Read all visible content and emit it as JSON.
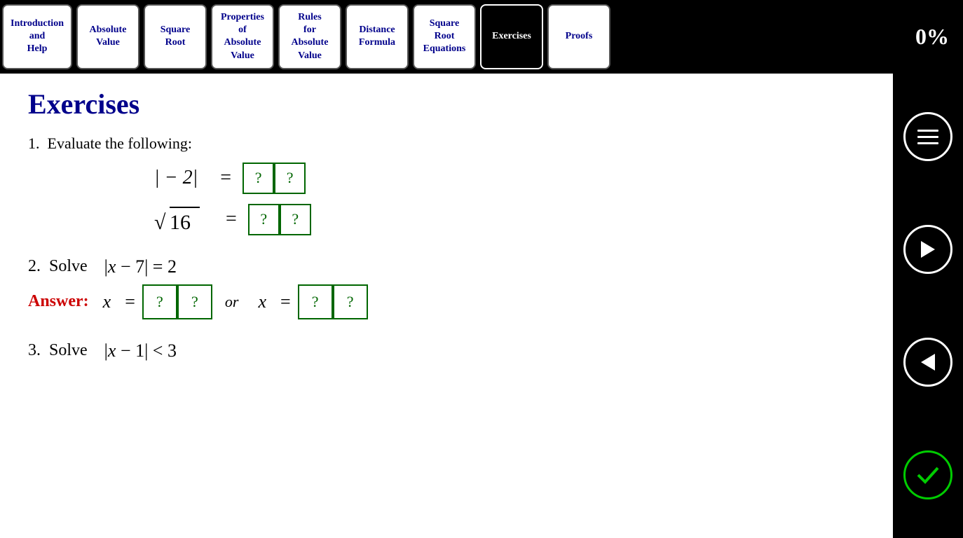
{
  "nav": {
    "tabs": [
      {
        "label": "Introduction\nand\nHelp",
        "active": false
      },
      {
        "label": "Absolute\nValue",
        "active": false
      },
      {
        "label": "Square\nRoot",
        "active": false
      },
      {
        "label": "Properties\nof\nAbsolute\nValue",
        "active": false
      },
      {
        "label": "Rules\nfor\nAbsolute\nValue",
        "active": false
      },
      {
        "label": "Distance\nFormula",
        "active": false
      },
      {
        "label": "Square\nRoot\nEquations",
        "active": false
      },
      {
        "label": "Exercises",
        "active": true
      },
      {
        "label": "Proofs",
        "active": false
      }
    ],
    "percent": "0%"
  },
  "main": {
    "title": "Exercises",
    "problem1": {
      "number": "1.",
      "text": "Evaluate the following:",
      "eq1": {
        "left": "| − 2|",
        "eq": "=",
        "box1": "?",
        "box2": "?"
      },
      "eq2": {
        "left": "√16",
        "eq": "=",
        "box1": "?",
        "box2": "?"
      }
    },
    "problem2": {
      "number": "2.",
      "verb": "Solve",
      "equation": "|x − 7| = 2",
      "answer_label": "Answer:",
      "x_label1": "x",
      "eq1": "=",
      "box1_1": "?",
      "box1_2": "?",
      "or": "or",
      "x_label2": "x",
      "eq2": "=",
      "box2_1": "?",
      "box2_2": "?"
    },
    "problem3": {
      "number": "3.",
      "verb": "Solve",
      "equation": "|x − 1| < 3"
    }
  },
  "sidebar": {
    "menu_icon": "≡",
    "forward_icon": "→",
    "back_icon": "←",
    "check_icon": "✓"
  }
}
